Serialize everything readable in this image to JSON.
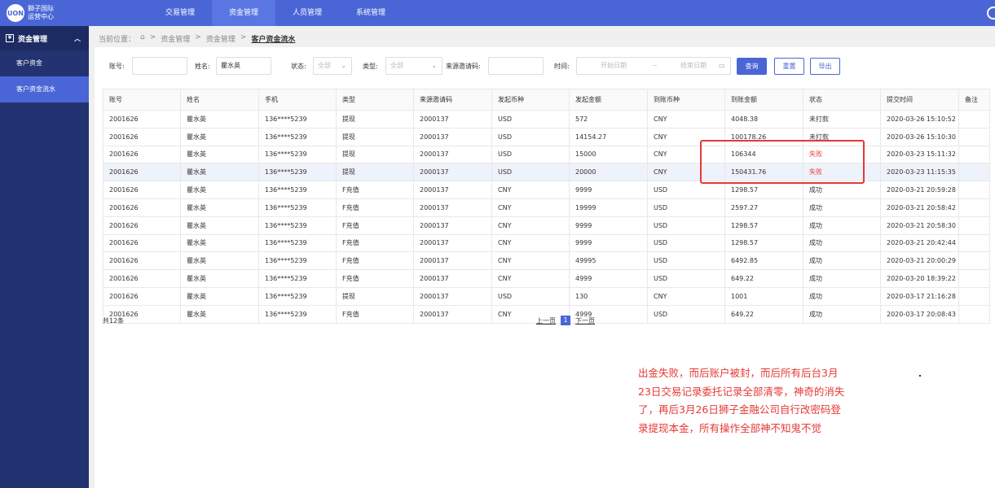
{
  "logo": {
    "mark": "UON",
    "line1": "獅子国际",
    "line2": "运营中心"
  },
  "nav": [
    "交易管理",
    "资金管理",
    "人员管理",
    "系统管理"
  ],
  "sidebar": {
    "header": "资金管理",
    "items": [
      "客户资金",
      "客户资金流水"
    ]
  },
  "breadcrumb": {
    "prefix": "当前位置：",
    "home": "⌂",
    "sep": ">",
    "parts": [
      "资金管理",
      "资金管理"
    ],
    "current": "客户资金流水"
  },
  "filters": {
    "account_label": "账号:",
    "account_value": "",
    "name_label": "姓名:",
    "name_value": "瞿水英",
    "status_label": "状态:",
    "status_value": "全部",
    "type_label": "类型:",
    "type_value": "全部",
    "invite_label": "来源邀请码:",
    "invite_value": "",
    "time_label": "时间:",
    "start_ph": "开始日期",
    "range_sep": "~",
    "end_ph": "结束日期",
    "search_btn": "查询",
    "reset_btn": "重置",
    "export_btn": "导出"
  },
  "table": {
    "headers": [
      "账号",
      "姓名",
      "手机",
      "类型",
      "来源邀请码",
      "发起币种",
      "发起金额",
      "到账币种",
      "到账金额",
      "状态",
      "提交时间",
      "备注"
    ],
    "rows": [
      [
        "2001626",
        "瞿水英",
        "136****5239",
        "提现",
        "2000137",
        "USD",
        "572",
        "CNY",
        "4048.38",
        "未打款",
        "2020-03-26 15:10:52",
        ""
      ],
      [
        "2001626",
        "瞿水英",
        "136****5239",
        "提现",
        "2000137",
        "USD",
        "14154.27",
        "CNY",
        "100178.26",
        "未打款",
        "2020-03-26 15:10:30",
        ""
      ],
      [
        "2001626",
        "瞿水英",
        "136****5239",
        "提现",
        "2000137",
        "USD",
        "15000",
        "CNY",
        "106344",
        "失败",
        "2020-03-23 15:11:32",
        ""
      ],
      [
        "2001626",
        "瞿水英",
        "136****5239",
        "提现",
        "2000137",
        "USD",
        "20000",
        "CNY",
        "150431.76",
        "失败",
        "2020-03-23 11:15:35",
        ""
      ],
      [
        "2001626",
        "瞿水英",
        "136****5239",
        "F充值",
        "2000137",
        "CNY",
        "9999",
        "USD",
        "1298.57",
        "成功",
        "2020-03-21 20:59:28",
        ""
      ],
      [
        "2001626",
        "瞿水英",
        "136****5239",
        "F充值",
        "2000137",
        "CNY",
        "19999",
        "USD",
        "2597.27",
        "成功",
        "2020-03-21 20:58:42",
        ""
      ],
      [
        "2001626",
        "瞿水英",
        "136****5239",
        "F充值",
        "2000137",
        "CNY",
        "9999",
        "USD",
        "1298.57",
        "成功",
        "2020-03-21 20:58:30",
        ""
      ],
      [
        "2001626",
        "瞿水英",
        "136****5239",
        "F充值",
        "2000137",
        "CNY",
        "9999",
        "USD",
        "1298.57",
        "成功",
        "2020-03-21 20:42:44",
        ""
      ],
      [
        "2001626",
        "瞿水英",
        "136****5239",
        "F充值",
        "2000137",
        "CNY",
        "49995",
        "USD",
        "6492.85",
        "成功",
        "2020-03-21 20:00:29",
        ""
      ],
      [
        "2001626",
        "瞿水英",
        "136****5239",
        "F充值",
        "2000137",
        "CNY",
        "4999",
        "USD",
        "649.22",
        "成功",
        "2020-03-20 18:39:22",
        ""
      ],
      [
        "2001626",
        "瞿水英",
        "136****5239",
        "提现",
        "2000137",
        "USD",
        "130",
        "CNY",
        "1001",
        "成功",
        "2020-03-17 21:16:28",
        ""
      ],
      [
        "2001626",
        "瞿水英",
        "136****5239",
        "F充值",
        "2000137",
        "CNY",
        "4999",
        "USD",
        "649.22",
        "成功",
        "2020-03-17 20:08:43",
        ""
      ]
    ]
  },
  "pagination": {
    "total": "共12条",
    "prev": "上一页",
    "page": "1",
    "next": "下一页"
  },
  "annotation": "出金失败，而后账户被封，而后所有后台3月23日交易记录委托记录全部清零，神奇的消失了，再后3月26日狮子金融公司自行改密码登录提现本金，所有操作全部神不知鬼不觉",
  "colors": {
    "primary": "#4a66d6",
    "sidebar": "#233270",
    "alert": "#e53935"
  }
}
